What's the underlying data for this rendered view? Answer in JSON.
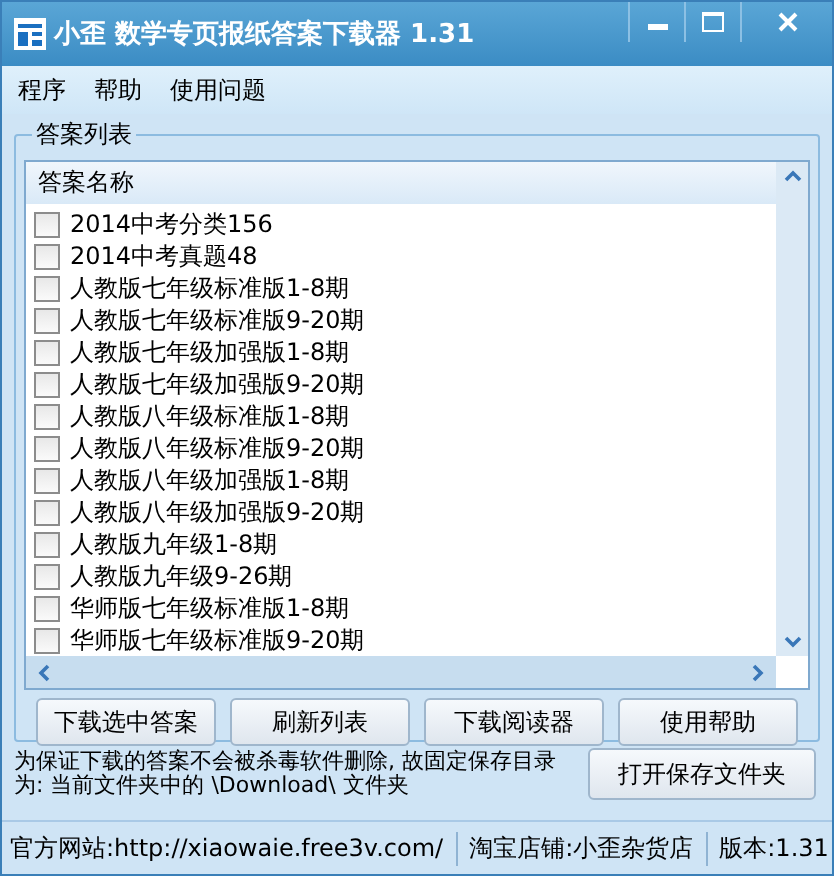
{
  "window": {
    "title": "小歪 数学专页报纸答案下载器 1.31"
  },
  "menu": [
    {
      "label": "程序"
    },
    {
      "label": "帮助"
    },
    {
      "label": "使用问题"
    }
  ],
  "group": {
    "title": "答案列表"
  },
  "list": {
    "column": "答案名称",
    "rows": [
      {
        "label": "2014中考分类156",
        "checked": false
      },
      {
        "label": "2014中考真题48",
        "checked": false
      },
      {
        "label": "人教版七年级标准版1-8期",
        "checked": false
      },
      {
        "label": "人教版七年级标准版9-20期",
        "checked": false
      },
      {
        "label": "人教版七年级加强版1-8期",
        "checked": false
      },
      {
        "label": "人教版七年级加强版9-20期",
        "checked": false
      },
      {
        "label": "人教版八年级标准版1-8期",
        "checked": false
      },
      {
        "label": "人教版八年级标准版9-20期",
        "checked": false
      },
      {
        "label": "人教版八年级加强版1-8期",
        "checked": false
      },
      {
        "label": "人教版八年级加强版9-20期",
        "checked": false
      },
      {
        "label": "人教版九年级1-8期",
        "checked": false
      },
      {
        "label": "人教版九年级9-26期",
        "checked": false
      },
      {
        "label": "华师版七年级标准版1-8期",
        "checked": false
      },
      {
        "label": "华师版七年级标准版9-20期",
        "checked": false
      }
    ]
  },
  "buttons": [
    "下载选中答案",
    "刷新列表",
    "下载阅读器",
    "使用帮助"
  ],
  "notice": "为保证下载的答案不会被杀毒软件删除, 故固定保存目录为: 当前文件夹中的 \\Download\\ 文件夹",
  "open_folder_button": "打开保存文件夹",
  "status_bar": [
    "官方网站:http://xiaowaie.free3v.com/",
    "淘宝店铺:小歪杂货店",
    "版本:1.31"
  ]
}
